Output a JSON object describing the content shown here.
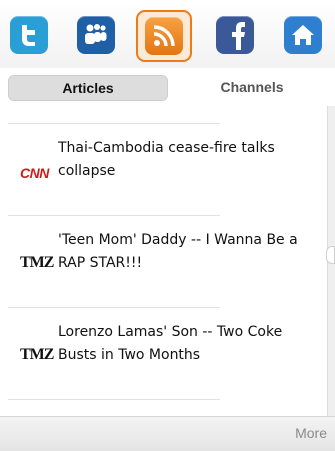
{
  "topbar": {
    "icons": [
      {
        "name": "twitter-icon",
        "color": "#2a9fd6"
      },
      {
        "name": "myspace-icon",
        "color": "#1f5fa6"
      },
      {
        "name": "rss-icon",
        "color": "#f08a24",
        "selected": true
      },
      {
        "name": "facebook-icon",
        "color": "#3b5998"
      },
      {
        "name": "home-icon",
        "color": "#2f7fd1"
      }
    ]
  },
  "tabs": {
    "articles_label": "Articles",
    "channels_label": "Channels"
  },
  "articles": [
    {
      "source": "CNN",
      "title": "Thai-Cambodia cease-fire talks collapse"
    },
    {
      "source": "TMZ",
      "title": "'Teen Mom' Daddy -- I Wanna Be a RAP STAR!!!"
    },
    {
      "source": "TMZ",
      "title": "Lorenzo Lamas' Son -- Two Coke Busts in Two Months"
    }
  ],
  "bottombar": {
    "more_label": "More"
  }
}
